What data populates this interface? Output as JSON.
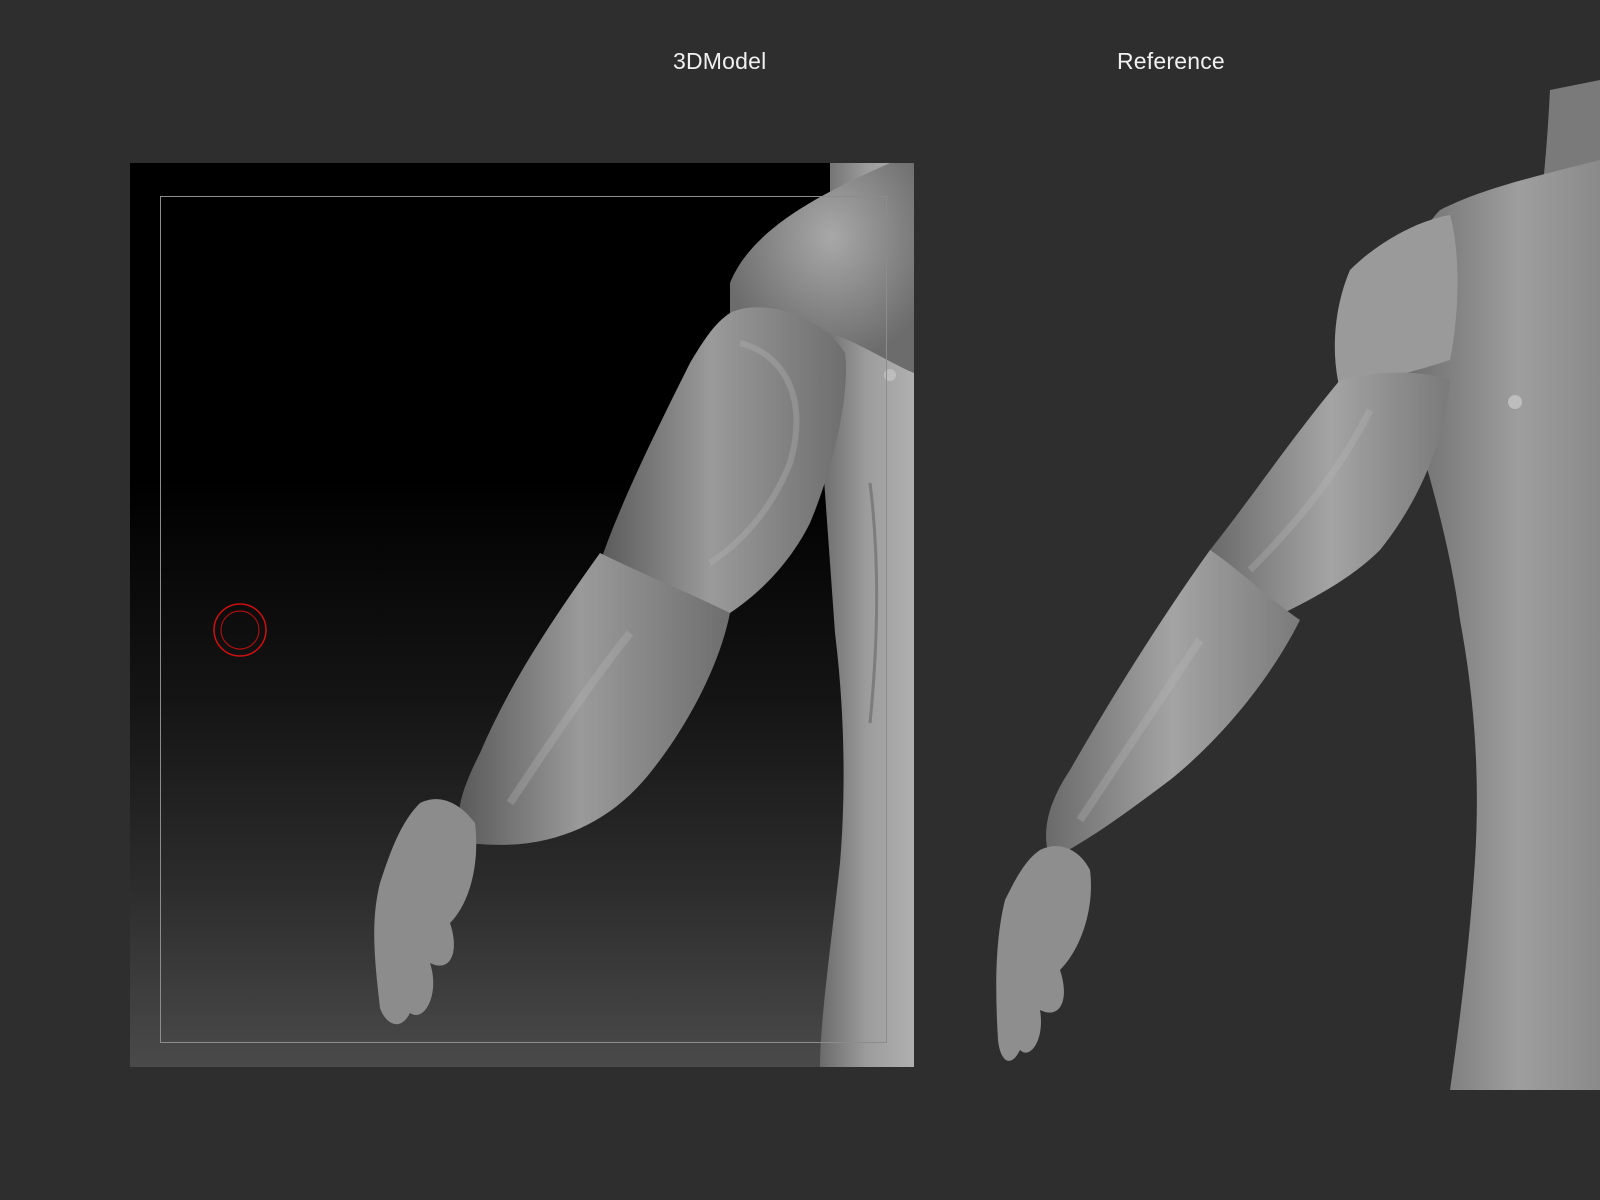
{
  "labels": {
    "model": "3DModel",
    "reference": "Reference"
  },
  "viewport": {
    "background_top": "#000000",
    "background_bottom": "#4a4a4a",
    "frame_color": "#8c8c8c"
  },
  "brush_cursor": {
    "icon": "brush-circle-icon",
    "color": "#d01010"
  },
  "colors": {
    "app_background": "#2e2e2e",
    "label_text": "#f0f0f0",
    "sculpt_clay": "#8a8a8a"
  }
}
